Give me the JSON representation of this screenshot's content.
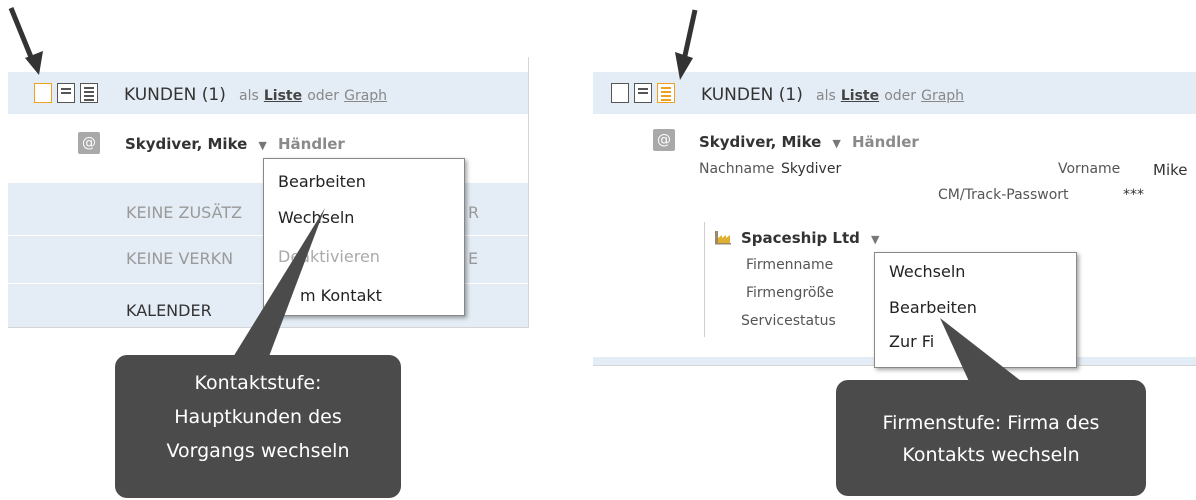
{
  "left": {
    "header": {
      "title": "KUNDEN (1)",
      "als": "als",
      "liste": "Liste",
      "oder": "oder",
      "graph": "Graph"
    },
    "contact": {
      "at_symbol": "@",
      "name": "Skydiver, Mike",
      "role": "Händler"
    },
    "rows": [
      "KEINE ZUSÄTZ",
      "R",
      "KEINE VERKN",
      "E",
      "KALENDER"
    ],
    "menu": [
      "Bearbeiten",
      "Wechseln",
      "Deaktivieren",
      "m Kontakt"
    ],
    "callout": [
      "Kontaktstufe:",
      "Hauptkunden des",
      "Vorgangs wechseln"
    ]
  },
  "right": {
    "header": {
      "title": "KUNDEN (1)",
      "als": "als",
      "liste": "Liste",
      "oder": "oder",
      "graph": "Graph"
    },
    "contact": {
      "at_symbol": "@",
      "name": "Skydiver, Mike",
      "role": "Händler",
      "nachname_label": "Nachname",
      "nachname_value": "Skydiver",
      "vorname_label": "Vorname",
      "vorname_value": "Mike",
      "passwort_label": "CM/Track-Passwort",
      "passwort_value": "***"
    },
    "company": {
      "name": "Spaceship Ltd",
      "fields": [
        "Firmenname",
        "Firmengröße",
        "Servicestatus"
      ]
    },
    "menu": [
      "Wechseln",
      "Bearbeiten",
      "Zur Fi"
    ],
    "callout": [
      "Firmenstufe: Firma des",
      "Kontakts wechseln"
    ]
  },
  "colors": {
    "accent": "#f0a020",
    "header_bg": "#e4ecf5",
    "callout_bg": "#4b4b4b"
  }
}
